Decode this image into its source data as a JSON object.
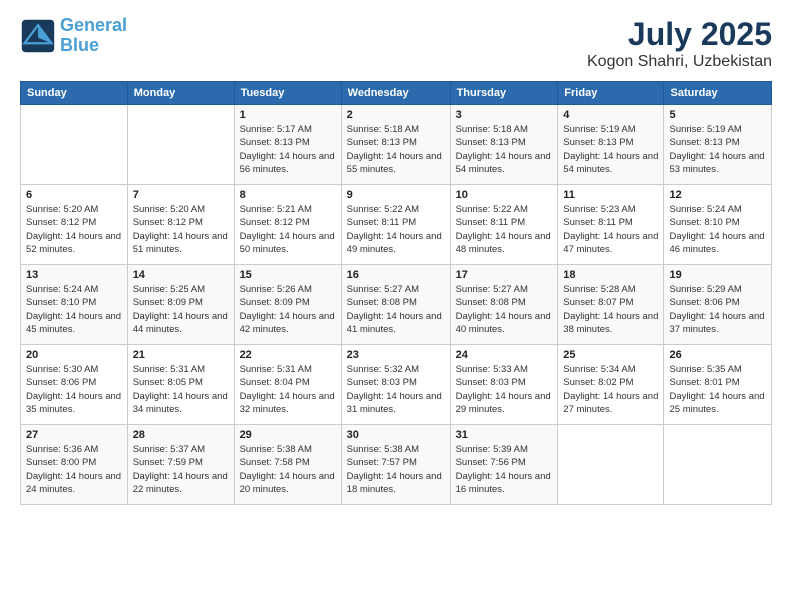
{
  "header": {
    "logo_line1": "General",
    "logo_line2": "Blue",
    "title": "July 2025",
    "subtitle": "Kogon Shahri, Uzbekistan"
  },
  "weekdays": [
    "Sunday",
    "Monday",
    "Tuesday",
    "Wednesday",
    "Thursday",
    "Friday",
    "Saturday"
  ],
  "weeks": [
    [
      {
        "day": "",
        "info": ""
      },
      {
        "day": "",
        "info": ""
      },
      {
        "day": "1",
        "info": "Sunrise: 5:17 AM\nSunset: 8:13 PM\nDaylight: 14 hours and 56 minutes."
      },
      {
        "day": "2",
        "info": "Sunrise: 5:18 AM\nSunset: 8:13 PM\nDaylight: 14 hours and 55 minutes."
      },
      {
        "day": "3",
        "info": "Sunrise: 5:18 AM\nSunset: 8:13 PM\nDaylight: 14 hours and 54 minutes."
      },
      {
        "day": "4",
        "info": "Sunrise: 5:19 AM\nSunset: 8:13 PM\nDaylight: 14 hours and 54 minutes."
      },
      {
        "day": "5",
        "info": "Sunrise: 5:19 AM\nSunset: 8:13 PM\nDaylight: 14 hours and 53 minutes."
      }
    ],
    [
      {
        "day": "6",
        "info": "Sunrise: 5:20 AM\nSunset: 8:12 PM\nDaylight: 14 hours and 52 minutes."
      },
      {
        "day": "7",
        "info": "Sunrise: 5:20 AM\nSunset: 8:12 PM\nDaylight: 14 hours and 51 minutes."
      },
      {
        "day": "8",
        "info": "Sunrise: 5:21 AM\nSunset: 8:12 PM\nDaylight: 14 hours and 50 minutes."
      },
      {
        "day": "9",
        "info": "Sunrise: 5:22 AM\nSunset: 8:11 PM\nDaylight: 14 hours and 49 minutes."
      },
      {
        "day": "10",
        "info": "Sunrise: 5:22 AM\nSunset: 8:11 PM\nDaylight: 14 hours and 48 minutes."
      },
      {
        "day": "11",
        "info": "Sunrise: 5:23 AM\nSunset: 8:11 PM\nDaylight: 14 hours and 47 minutes."
      },
      {
        "day": "12",
        "info": "Sunrise: 5:24 AM\nSunset: 8:10 PM\nDaylight: 14 hours and 46 minutes."
      }
    ],
    [
      {
        "day": "13",
        "info": "Sunrise: 5:24 AM\nSunset: 8:10 PM\nDaylight: 14 hours and 45 minutes."
      },
      {
        "day": "14",
        "info": "Sunrise: 5:25 AM\nSunset: 8:09 PM\nDaylight: 14 hours and 44 minutes."
      },
      {
        "day": "15",
        "info": "Sunrise: 5:26 AM\nSunset: 8:09 PM\nDaylight: 14 hours and 42 minutes."
      },
      {
        "day": "16",
        "info": "Sunrise: 5:27 AM\nSunset: 8:08 PM\nDaylight: 14 hours and 41 minutes."
      },
      {
        "day": "17",
        "info": "Sunrise: 5:27 AM\nSunset: 8:08 PM\nDaylight: 14 hours and 40 minutes."
      },
      {
        "day": "18",
        "info": "Sunrise: 5:28 AM\nSunset: 8:07 PM\nDaylight: 14 hours and 38 minutes."
      },
      {
        "day": "19",
        "info": "Sunrise: 5:29 AM\nSunset: 8:06 PM\nDaylight: 14 hours and 37 minutes."
      }
    ],
    [
      {
        "day": "20",
        "info": "Sunrise: 5:30 AM\nSunset: 8:06 PM\nDaylight: 14 hours and 35 minutes."
      },
      {
        "day": "21",
        "info": "Sunrise: 5:31 AM\nSunset: 8:05 PM\nDaylight: 14 hours and 34 minutes."
      },
      {
        "day": "22",
        "info": "Sunrise: 5:31 AM\nSunset: 8:04 PM\nDaylight: 14 hours and 32 minutes."
      },
      {
        "day": "23",
        "info": "Sunrise: 5:32 AM\nSunset: 8:03 PM\nDaylight: 14 hours and 31 minutes."
      },
      {
        "day": "24",
        "info": "Sunrise: 5:33 AM\nSunset: 8:03 PM\nDaylight: 14 hours and 29 minutes."
      },
      {
        "day": "25",
        "info": "Sunrise: 5:34 AM\nSunset: 8:02 PM\nDaylight: 14 hours and 27 minutes."
      },
      {
        "day": "26",
        "info": "Sunrise: 5:35 AM\nSunset: 8:01 PM\nDaylight: 14 hours and 25 minutes."
      }
    ],
    [
      {
        "day": "27",
        "info": "Sunrise: 5:36 AM\nSunset: 8:00 PM\nDaylight: 14 hours and 24 minutes."
      },
      {
        "day": "28",
        "info": "Sunrise: 5:37 AM\nSunset: 7:59 PM\nDaylight: 14 hours and 22 minutes."
      },
      {
        "day": "29",
        "info": "Sunrise: 5:38 AM\nSunset: 7:58 PM\nDaylight: 14 hours and 20 minutes."
      },
      {
        "day": "30",
        "info": "Sunrise: 5:38 AM\nSunset: 7:57 PM\nDaylight: 14 hours and 18 minutes."
      },
      {
        "day": "31",
        "info": "Sunrise: 5:39 AM\nSunset: 7:56 PM\nDaylight: 14 hours and 16 minutes."
      },
      {
        "day": "",
        "info": ""
      },
      {
        "day": "",
        "info": ""
      }
    ]
  ]
}
